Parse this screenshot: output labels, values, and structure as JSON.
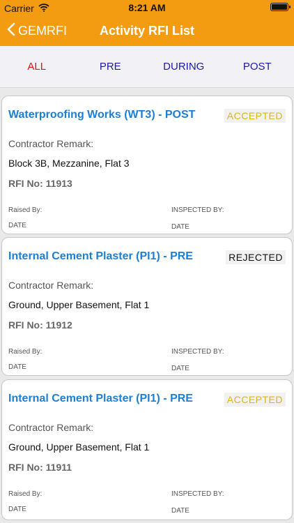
{
  "status_bar": {
    "carrier": "Carrier",
    "time": "8:21 AM"
  },
  "nav": {
    "back_label": "GEMRFI",
    "title": "Activity RFI List"
  },
  "tabs": [
    {
      "label": "ALL",
      "active": true
    },
    {
      "label": "PRE",
      "active": false
    },
    {
      "label": "DURING",
      "active": false
    },
    {
      "label": "POST",
      "active": false
    }
  ],
  "colors": {
    "accent": "#f39c12",
    "title_blue": "#1b7fd6",
    "accepted": "#d6b81a",
    "rejected": "#111111",
    "tab_active": "#e0101a",
    "tab_inactive": "#1a1aa6"
  },
  "cards": [
    {
      "title": "Waterproofing Works (WT3) - POST",
      "status": "ACCEPTED",
      "status_color": "#d6b81a",
      "remark_label": "Contractor Remark:",
      "remark": "Block 3B, Mezzanine, Flat 3",
      "rfi_label": "RFI No:",
      "rfi_number": "11913",
      "raised_by_label": "Raised By:",
      "raised_date": "DATE",
      "inspected_by_label": "INSPECTED BY:",
      "inspected_date": "DATE"
    },
    {
      "title": "Internal Cement Plaster (PI1) - PRE",
      "status": "REJECTED",
      "status_color": "#111111",
      "remark_label": "Contractor Remark:",
      "remark": "Ground, Upper Basement, Flat 1",
      "rfi_label": "RFI No:",
      "rfi_number": "11912",
      "raised_by_label": "Raised By:",
      "raised_date": "DATE",
      "inspected_by_label": "INSPECTED BY:",
      "inspected_date": "DATE"
    },
    {
      "title": "Internal Cement Plaster (PI1) - PRE",
      "status": "ACCEPTED",
      "status_color": "#d6b81a",
      "remark_label": "Contractor Remark:",
      "remark": "Ground, Upper Basement, Flat 1",
      "rfi_label": "RFI No:",
      "rfi_number": "11911",
      "raised_by_label": "Raised By:",
      "raised_date": "DATE",
      "inspected_by_label": "INSPECTED BY:",
      "inspected_date": "DATE"
    }
  ]
}
